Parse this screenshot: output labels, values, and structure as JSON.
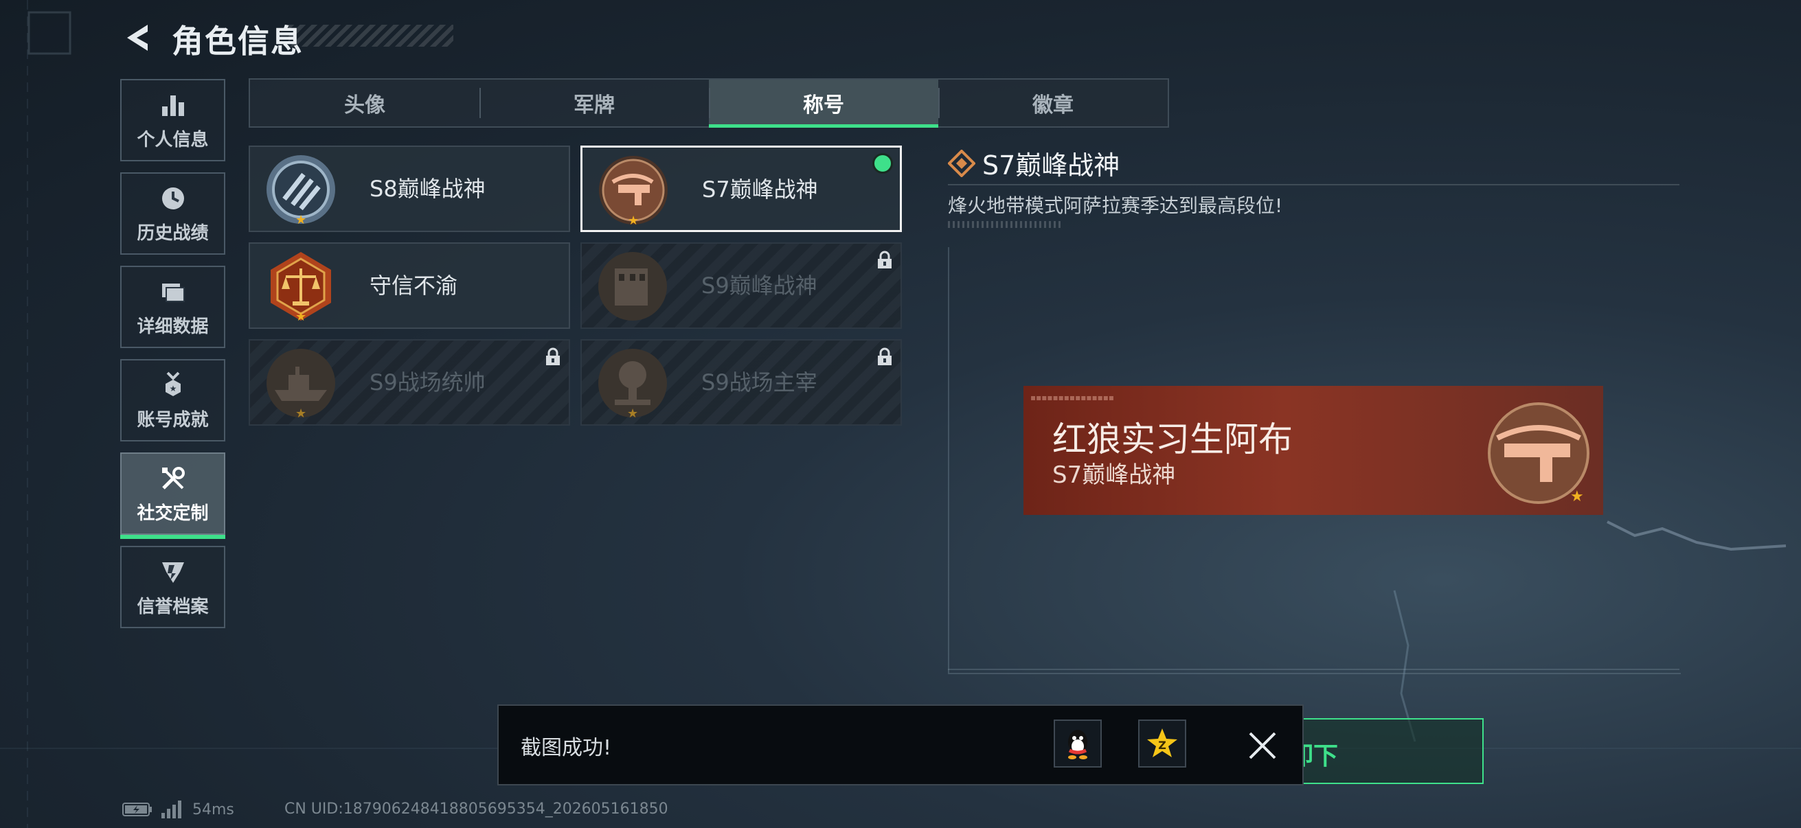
{
  "header": {
    "title": "角色信息"
  },
  "nav": {
    "items": [
      {
        "label": "个人信息",
        "icon": "bar-chart-icon"
      },
      {
        "label": "历史战绩",
        "icon": "clock-icon"
      },
      {
        "label": "详细数据",
        "icon": "folder-icon"
      },
      {
        "label": "账号成就",
        "icon": "medal-icon"
      },
      {
        "label": "社交定制",
        "icon": "tools-icon",
        "active": true
      },
      {
        "label": "信誉档案",
        "icon": "shield-badge-icon"
      }
    ]
  },
  "tabs": [
    {
      "label": "头像"
    },
    {
      "label": "军牌"
    },
    {
      "label": "称号",
      "active": true
    },
    {
      "label": "徽章"
    }
  ],
  "titles": [
    {
      "name": "S8巅峰战神",
      "locked": false,
      "emblem": "s8-emblem-icon"
    },
    {
      "name": "S7巅峰战神",
      "locked": false,
      "selected": true,
      "equipped": true,
      "emblem": "crossbow-emblem-icon"
    },
    {
      "name": "守信不渝",
      "locked": false,
      "emblem": "scales-emblem-icon"
    },
    {
      "name": "S9巅峰战神",
      "locked": true,
      "emblem": "building-emblem-icon"
    },
    {
      "name": "S9战场统帅",
      "locked": true,
      "emblem": "ship-emblem-icon"
    },
    {
      "name": "S9战场主宰",
      "locked": true,
      "emblem": "explosion-emblem-icon"
    }
  ],
  "detail": {
    "title": "S7巅峰战神",
    "description": "烽火地带模式阿萨拉赛季达到最高段位!"
  },
  "preview": {
    "player_name": "红狼实习生阿布",
    "title": "S7巅峰战神"
  },
  "toast": {
    "text": "截图成功!",
    "share_icons": [
      "qq-icon",
      "qzone-icon"
    ]
  },
  "unequip_button": {
    "label": "卸下",
    "visible_label": "卸下"
  },
  "status": {
    "ping": "54ms",
    "uid": "CN UID:18790624841880569​5354_202605161850"
  },
  "colors": {
    "accent": "#3ee08a",
    "banner": "#8a3424"
  }
}
